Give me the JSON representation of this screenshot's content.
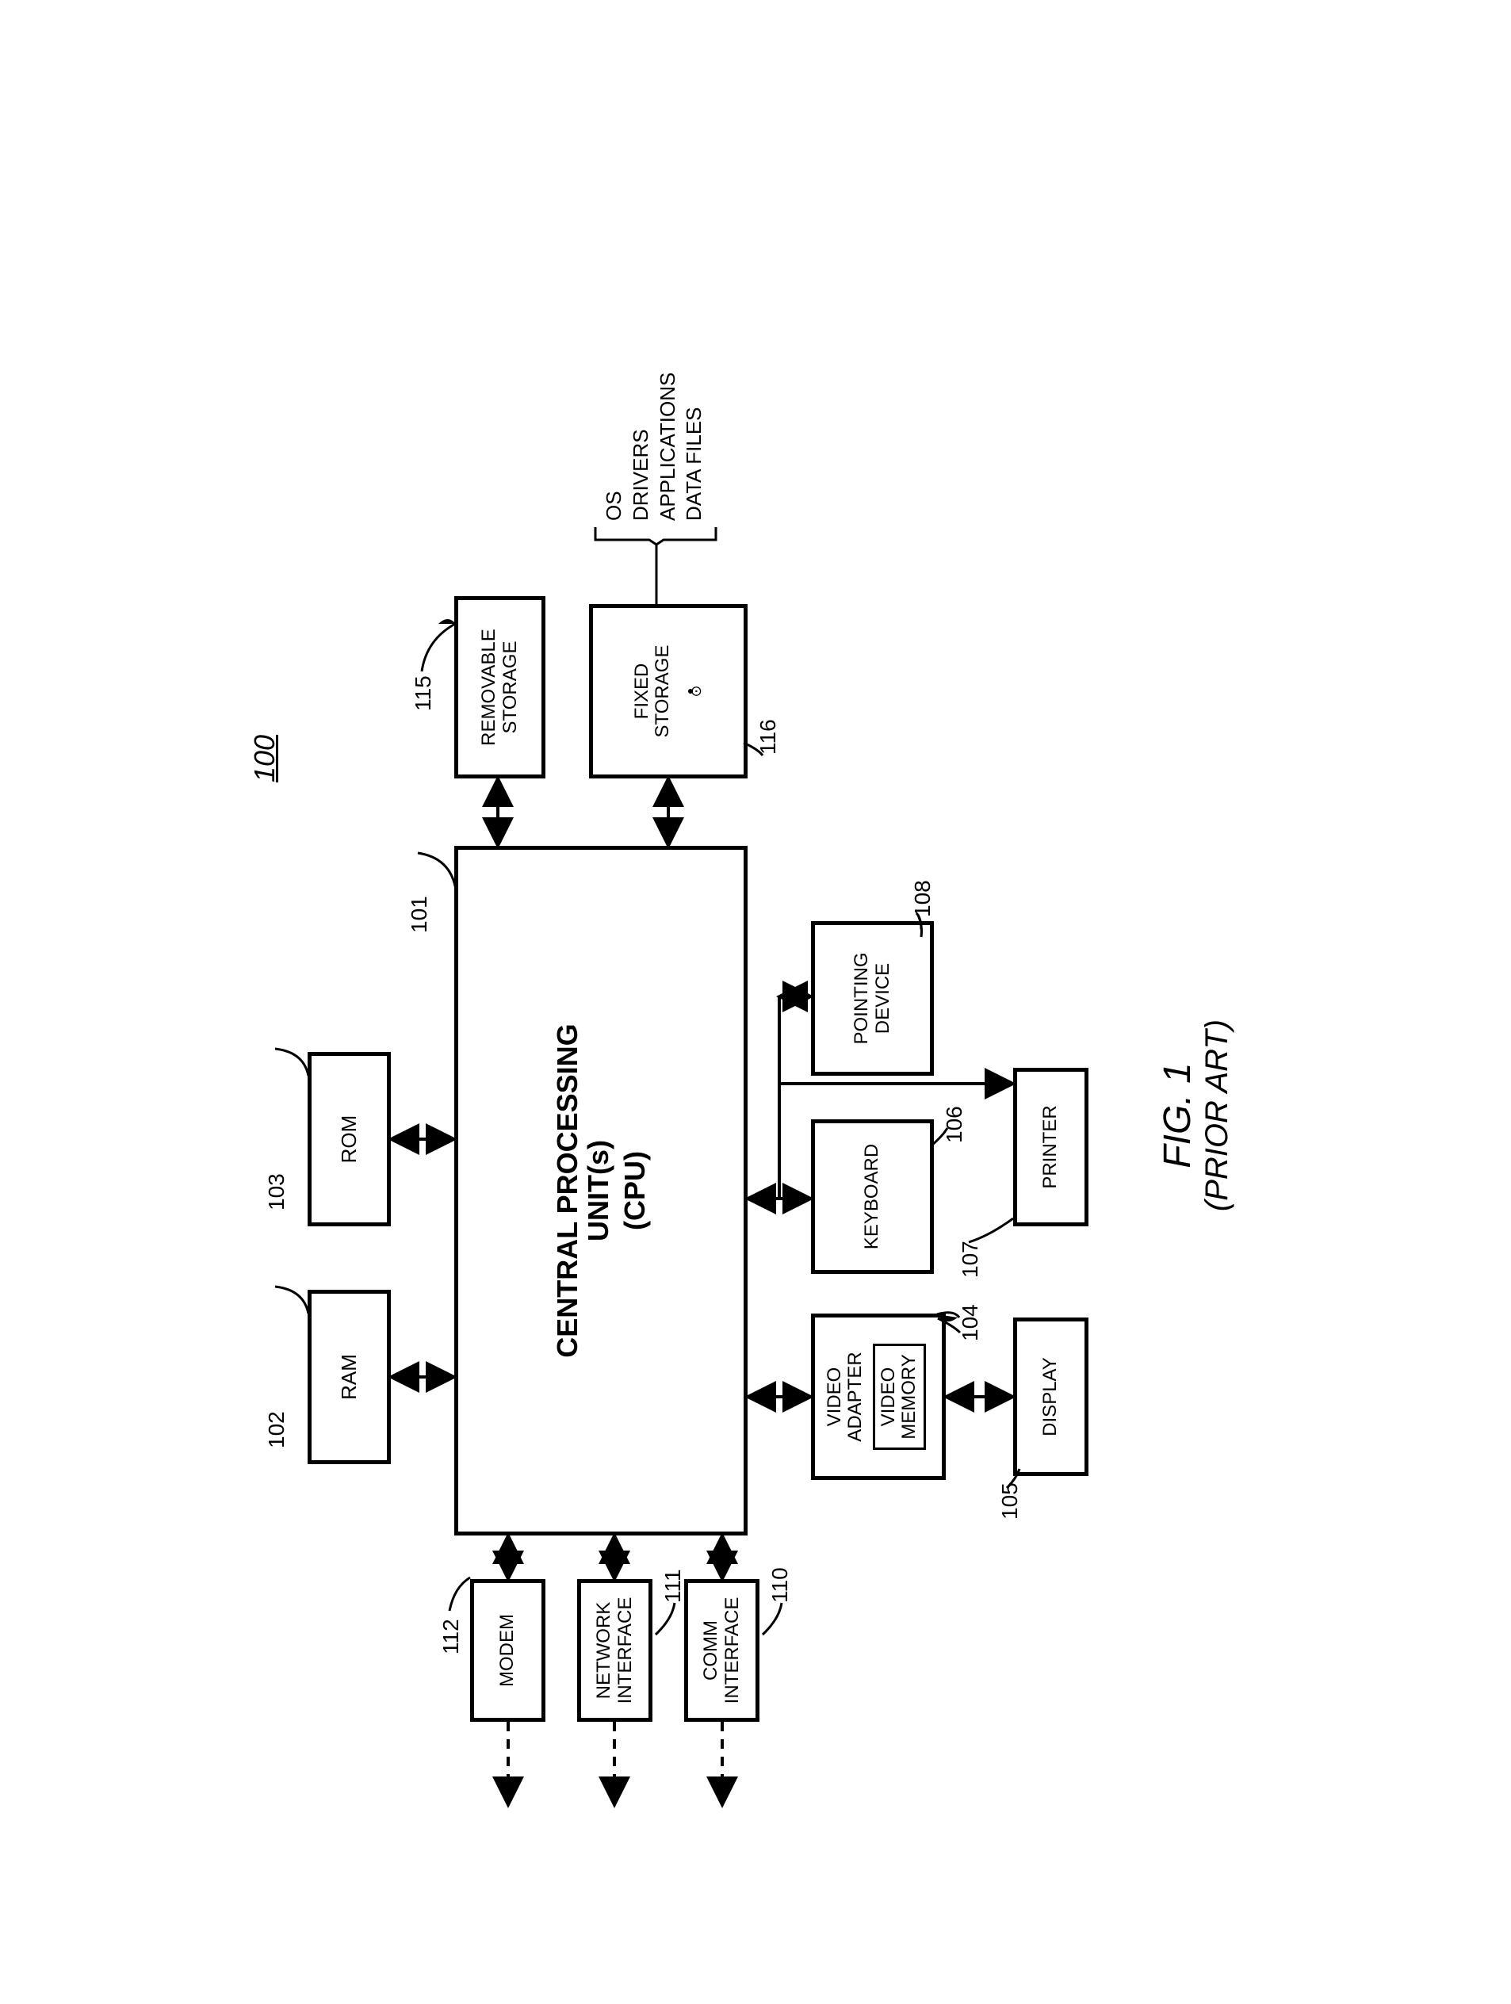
{
  "figure": {
    "number": "FIG. 1",
    "caption": "(PRIOR ART)",
    "system_ref": "100"
  },
  "blocks": {
    "cpu": {
      "line1": "CENTRAL PROCESSING",
      "line2": "UNIT(s)",
      "line3": "(CPU)",
      "ref": "101"
    },
    "ram": {
      "label": "RAM",
      "ref": "102"
    },
    "rom": {
      "label": "ROM",
      "ref": "103"
    },
    "video": {
      "label1": "VIDEO",
      "label2": "ADAPTER",
      "sub": "VIDEO\nMEMORY",
      "ref": "104"
    },
    "display": {
      "label": "DISPLAY",
      "ref": "105"
    },
    "keyboard": {
      "label": "KEYBOARD",
      "ref": "106"
    },
    "printer": {
      "label": "PRINTER",
      "ref": "107"
    },
    "pointing": {
      "line1": "POINTING",
      "line2": "DEVICE",
      "ref": "108"
    },
    "comm": {
      "line1": "COMM",
      "line2": "INTERFACE",
      "ref": "110"
    },
    "netif": {
      "line1": "NETWORK",
      "line2": "INTERFACE",
      "ref": "111"
    },
    "modem": {
      "label": "MODEM",
      "ref": "112"
    },
    "removable": {
      "line1": "REMOVABLE",
      "line2": "STORAGE",
      "ref": "115"
    },
    "fixed": {
      "line1": "FIXED",
      "line2": "STORAGE",
      "ref": "116"
    }
  },
  "storage_contents": {
    "i0": "OS",
    "i1": "DRIVERS",
    "i2": "APPLICATIONS",
    "i3": "DATA FILES"
  }
}
